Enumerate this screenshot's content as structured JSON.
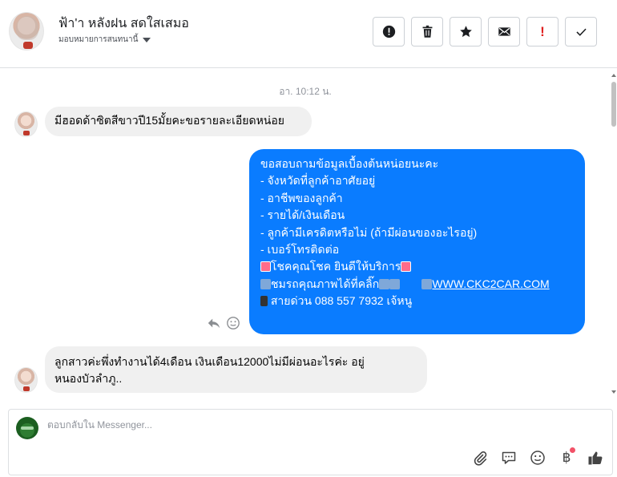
{
  "header": {
    "contact_name": "ฟ้า'า หลังฝน สดใสเสมอ",
    "assign_label": "มอบหมายการสนทนานี้",
    "buttons": [
      {
        "name": "report-button",
        "icon": "alert-circle-icon"
      },
      {
        "name": "delete-button",
        "icon": "trash-icon"
      },
      {
        "name": "star-button",
        "icon": "star-icon"
      },
      {
        "name": "mark-unread-button",
        "icon": "envelope-icon"
      },
      {
        "name": "follow-up-button",
        "icon": "exclamation-icon",
        "label": "!"
      },
      {
        "name": "mark-done-button",
        "icon": "check-icon"
      }
    ]
  },
  "chat": {
    "timestamp": "อา. 10:12 น.",
    "messages": [
      {
        "direction": "in",
        "text": "มีฮอดด้าซิตสีขาวปี15มั้ยคะขอรายละเอียดหน่อย"
      },
      {
        "direction": "out",
        "lines": [
          "ขอสอบถามข้อมูลเบื้องต้นหน่อยนะคะ",
          "- จังหวัดที่ลูกค้าอาศัยอยู่",
          "- อาชีพของลูกค้า",
          "- รายได้/เงินเดือน",
          "- ลูกค้ามีเครดิตหรือไม่ (ถ้ามีผ่อนของอะไรอยู่)",
          "- เบอร์โทรติดต่อ",
          "",
          "โชคคุณโชค ยินดีให้บริการ",
          "ชมรถคุณภาพได้ที่คลิ๊ก",
          "WWW.CKC2CAR.COM",
          "สายด่วน 088 557 7932 เจ้หนู"
        ]
      },
      {
        "direction": "in",
        "text_line1": "ลูกสาวค่ะพึ่งทำงานได้4เดือน เงินเดือน12000ไม่มีผ่อนอะไรค่ะ อยู่",
        "text_line2": "หนองบัวลำภู.."
      }
    ]
  },
  "composer": {
    "placeholder": "ตอบกลับใน Messenger...",
    "baht_symbol": "฿",
    "tools": [
      "paperclip-icon",
      "saved-reply-icon",
      "emoji-icon",
      "payment-icon",
      "thumbs-up-icon"
    ]
  },
  "colors": {
    "outgoing_bubble": "#0a7cff",
    "incoming_bubble": "#f0f0f0",
    "timestamp": "#90949c"
  }
}
